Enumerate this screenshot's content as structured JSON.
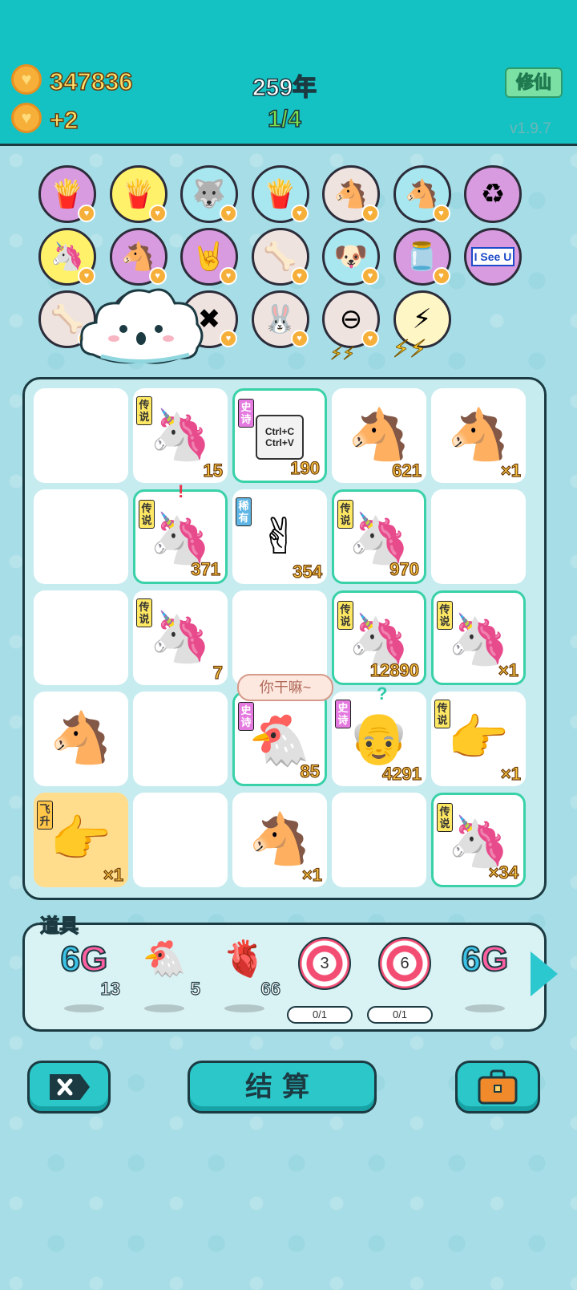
{
  "header": {
    "coins": "347836",
    "coin_rate": "+2",
    "year": "259年",
    "pages": "1/4",
    "xiuxian_label": "修仙",
    "version": "v1.9.7"
  },
  "buffs": [
    {
      "icon": "fries-icon",
      "glyph": "🍟",
      "bg": "#d99be0"
    },
    {
      "icon": "fries-icon",
      "glyph": "🍟",
      "bg": "#fff26a"
    },
    {
      "icon": "husky-icon",
      "glyph": "🐺",
      "bg": "#a8e6f0"
    },
    {
      "icon": "fries-icon",
      "glyph": "🍟",
      "bg": "#a8e6f0"
    },
    {
      "icon": "horse-pair-icon",
      "glyph": "🐴",
      "bg": "#efe3e0"
    },
    {
      "icon": "horse-pair-icon",
      "glyph": "🐴",
      "bg": "#a8e6f0"
    },
    {
      "icon": "recycle-icon",
      "glyph": "♻",
      "bg": "#d99be0"
    },
    {
      "icon": "unicorn-icon",
      "glyph": "🦄",
      "bg": "#fff26a"
    },
    {
      "icon": "horse-pair-icon",
      "glyph": "🐴",
      "bg": "#d99be0"
    },
    {
      "icon": "rock-hand-icon",
      "glyph": "🤘",
      "bg": "#d99be0"
    },
    {
      "icon": "dog-food-icon",
      "glyph": "🦴",
      "bg": "#efe3e0"
    },
    {
      "icon": "cool-dog-icon",
      "glyph": "🐶",
      "bg": "#a8e6f0"
    },
    {
      "icon": "jar-icon",
      "glyph": "🫙",
      "bg": "#d99be0"
    },
    {
      "icon": "i-see-u-icon",
      "glyph": "I See U",
      "bg": "#d99be0"
    },
    {
      "icon": "dog-food-icon",
      "glyph": "🦴",
      "bg": "#efe3e0"
    },
    {
      "icon": "grapefruit-icon",
      "glyph": "🍊",
      "bg": "#d99be0"
    },
    {
      "icon": "delete-tag-icon",
      "glyph": "✖",
      "bg": "#efe3e0"
    },
    {
      "icon": "rabbit-icon",
      "glyph": "🐰",
      "bg": "#efe3e0"
    },
    {
      "icon": "minus-icon",
      "glyph": "⊖",
      "bg": "#efe3e0"
    },
    {
      "icon": "lightning-icon",
      "glyph": "⚡",
      "bg": "#fff6c6"
    }
  ],
  "board": {
    "speech": "你干嘛~",
    "cells": [
      {
        "sprite": "",
        "rarity": "",
        "count": ""
      },
      {
        "sprite": "🦄",
        "rarity": "传说",
        "rarity_type": "legend",
        "count": "15"
      },
      {
        "sprite": "Ctrl+C Ctrl+V",
        "rarity": "史诗",
        "rarity_type": "epic",
        "count": "190",
        "border": true,
        "icon": "copy-paste-icon"
      },
      {
        "sprite": "🐴",
        "rarity": "",
        "count": "621",
        "icon": "horse-icon"
      },
      {
        "sprite": "🐴",
        "rarity": "",
        "count": "×1",
        "icon": "horse-icon"
      },
      {
        "sprite": "",
        "rarity": "",
        "count": ""
      },
      {
        "sprite": "🦄",
        "rarity": "传说",
        "rarity_type": "legend",
        "count": "371",
        "border": true
      },
      {
        "sprite": "✌",
        "rarity": "稀有",
        "rarity_type": "rare",
        "count": "354",
        "icon": "brown-hand-icon"
      },
      {
        "sprite": "🦄",
        "rarity": "传说",
        "rarity_type": "legend",
        "count": "970",
        "border": true,
        "icon": "crowned-unicorn-icon"
      },
      {
        "sprite": "",
        "rarity": "",
        "count": ""
      },
      {
        "sprite": "",
        "rarity": "",
        "count": ""
      },
      {
        "sprite": "🦄",
        "rarity": "传说",
        "rarity_type": "legend",
        "count": "7"
      },
      {
        "sprite": "",
        "rarity": "",
        "count": ""
      },
      {
        "sprite": "🦄",
        "rarity": "传说",
        "rarity_type": "legend",
        "count": "12890",
        "border": true,
        "icon": "basketball-unicorn-icon"
      },
      {
        "sprite": "🦄",
        "rarity": "传说",
        "rarity_type": "legend",
        "count": "×1",
        "border": true
      },
      {
        "sprite": "🐴",
        "rarity": "",
        "count": "",
        "icon": "horse-icon"
      },
      {
        "sprite": "",
        "rarity": "",
        "count": ""
      },
      {
        "sprite": "🐔",
        "rarity": "史诗",
        "rarity_type": "epic",
        "count": "85",
        "border": true,
        "icon": "basketball-chicken-icon"
      },
      {
        "sprite": "👴",
        "rarity": "史诗",
        "rarity_type": "epic",
        "count": "4291",
        "icon": "old-man-icon"
      },
      {
        "sprite": "👉",
        "rarity": "传说",
        "rarity_type": "legend",
        "count": "×1",
        "icon": "yellow-hand-icon"
      },
      {
        "sprite": "👉",
        "rarity": "飞升",
        "rarity_type": "fly",
        "count": "×1",
        "gold": true,
        "icon": "yellow-hand-icon"
      },
      {
        "sprite": "",
        "rarity": "",
        "count": ""
      },
      {
        "sprite": "🐴",
        "rarity": "",
        "count": "×1",
        "icon": "horse-icon"
      },
      {
        "sprite": "",
        "rarity": "",
        "count": ""
      },
      {
        "sprite": "🦄",
        "rarity": "传说",
        "rarity_type": "legend",
        "count": "×34",
        "border": true,
        "icon": "basketball-unicorn-icon"
      }
    ]
  },
  "props": {
    "label": "道具",
    "items": [
      {
        "type": "6g",
        "text": "6G",
        "count": "13"
      },
      {
        "type": "emoji",
        "glyph": "🐔",
        "icon": "chicken-icon",
        "count": "5"
      },
      {
        "type": "emoji",
        "glyph": "🫀",
        "icon": "liver-icon",
        "count": "66"
      },
      {
        "type": "target",
        "number": "3",
        "progress": "0/1"
      },
      {
        "type": "target",
        "number": "6",
        "progress": "0/1"
      },
      {
        "type": "6g",
        "text": "6G",
        "count": ""
      }
    ]
  },
  "buttons": {
    "settle_label": "结算"
  }
}
